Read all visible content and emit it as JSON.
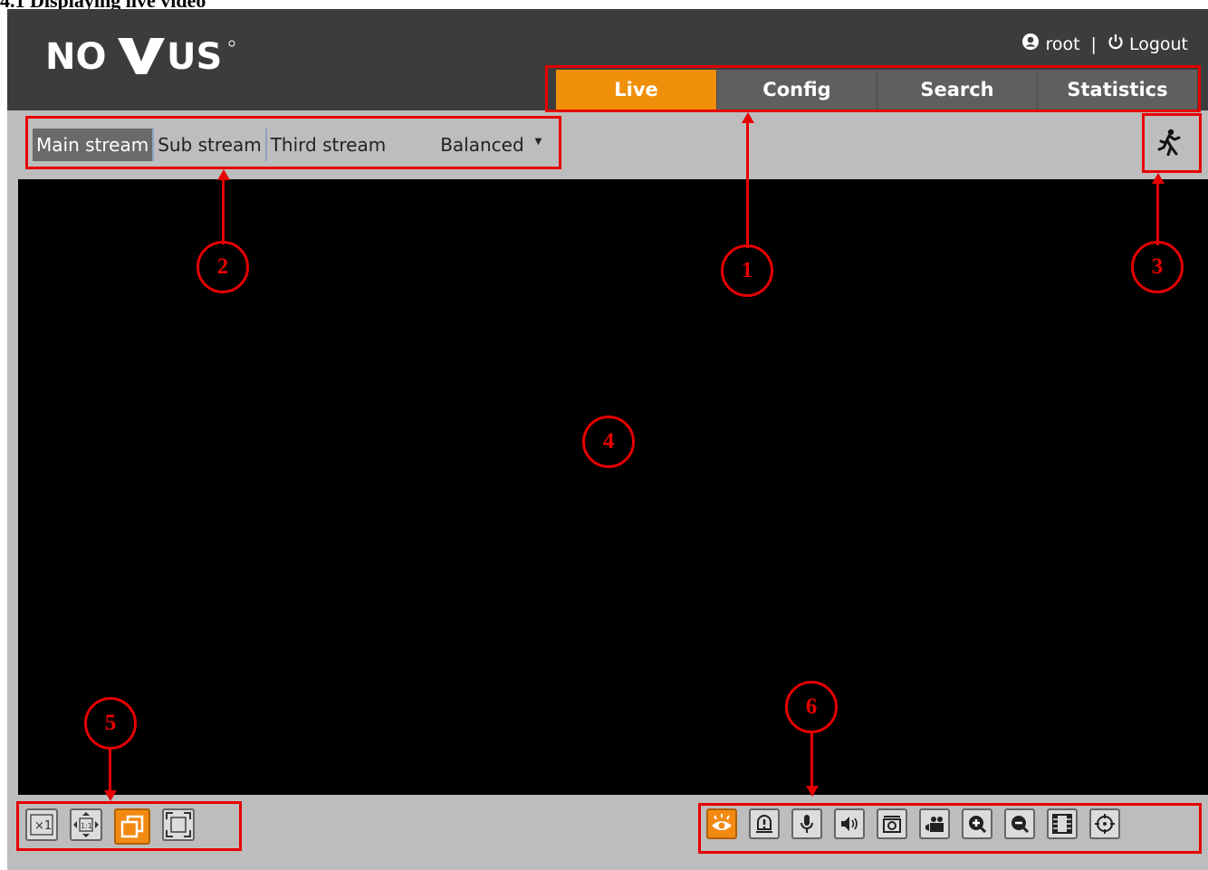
{
  "document": {
    "heading": "4.1 Displaying live video"
  },
  "header": {
    "logo_text": "NOVUS",
    "user": "root",
    "separator": "|",
    "logout_label": "Logout"
  },
  "nav": {
    "tabs": [
      {
        "label": "Live",
        "active": true
      },
      {
        "label": "Config",
        "active": false
      },
      {
        "label": "Search",
        "active": false
      },
      {
        "label": "Statistics",
        "active": false
      }
    ]
  },
  "streams": {
    "items": [
      {
        "label": "Main stream",
        "active": true
      },
      {
        "label": "Sub stream",
        "active": false
      },
      {
        "label": "Third stream",
        "active": false
      }
    ],
    "quality": "Balanced"
  },
  "view_controls": {
    "icons": [
      "original-size-icon",
      "fit-1-1-icon",
      "window-mode-icon",
      "fullscreen-icon"
    ]
  },
  "tool_controls": {
    "icons": [
      "live-view-eye-icon",
      "alarm-icon",
      "microphone-icon",
      "speaker-icon",
      "snapshot-icon",
      "record-icon",
      "zoom-in-icon",
      "zoom-out-icon",
      "film-icon",
      "ptz-target-icon"
    ]
  },
  "annotations": [
    "1",
    "2",
    "3",
    "4",
    "5",
    "6"
  ],
  "colors": {
    "accent": "#f0900a",
    "header_bg": "#3c3c3c",
    "tab_bg": "#5f5f5f",
    "panel_bg": "#bdbdbd",
    "annotation_red": "#e60000"
  }
}
